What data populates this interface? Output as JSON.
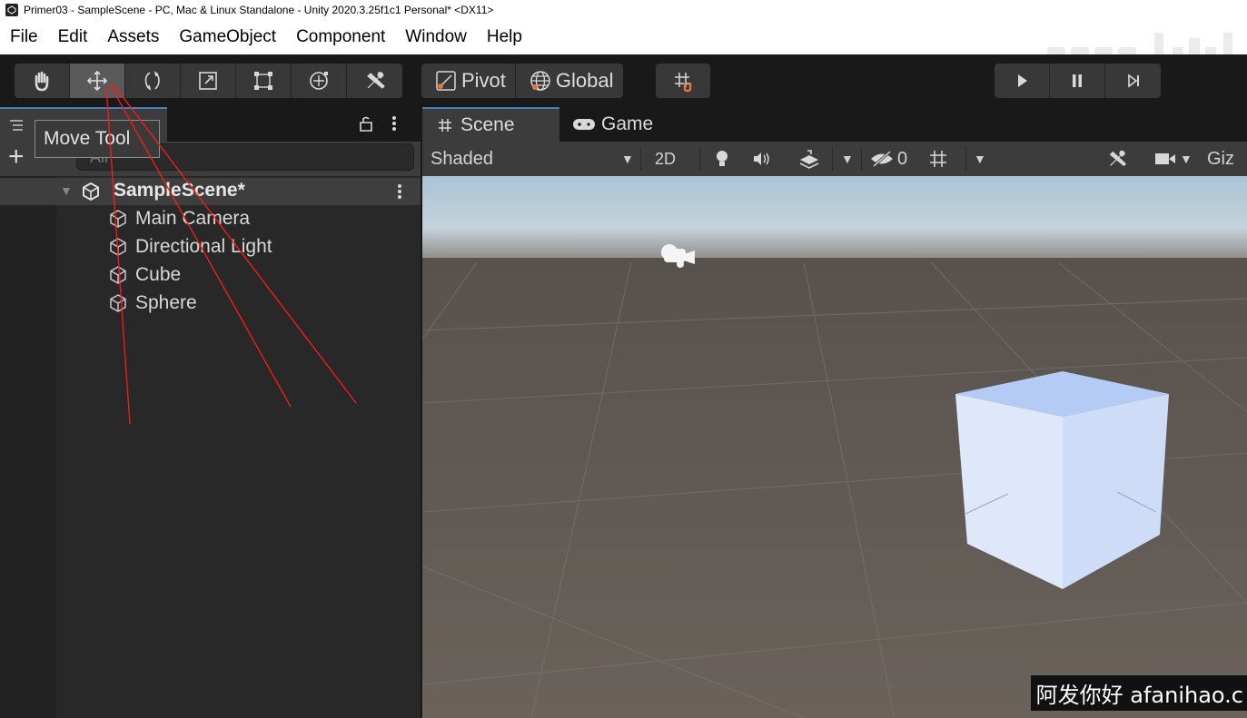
{
  "window": {
    "title": "Primer03 - SampleScene - PC, Mac & Linux Standalone - Unity 2020.3.25f1c1 Personal* <DX11>"
  },
  "menu": {
    "items": [
      "File",
      "Edit",
      "Assets",
      "GameObject",
      "Component",
      "Window",
      "Help"
    ]
  },
  "toolbar": {
    "tools": [
      {
        "name": "hand-tool",
        "icon": "hand-icon",
        "active": false
      },
      {
        "name": "move-tool",
        "icon": "move-icon",
        "active": true
      },
      {
        "name": "rotate-tool",
        "icon": "rotate-icon",
        "active": false
      },
      {
        "name": "scale-tool",
        "icon": "scale-icon",
        "active": false
      },
      {
        "name": "rect-tool",
        "icon": "rect-icon",
        "active": false
      },
      {
        "name": "transform-tool",
        "icon": "transform-icon",
        "active": false
      },
      {
        "name": "custom-tool",
        "icon": "tools-icon",
        "active": false
      }
    ],
    "pivot_label": "Pivot",
    "global_label": "Global"
  },
  "tooltip": {
    "text": "Move Tool"
  },
  "hierarchy": {
    "search_placeholder": "All",
    "scene_name": "SampleScene*",
    "objects": [
      "Main Camera",
      "Directional Light",
      "Cube",
      "Sphere"
    ]
  },
  "scene_view": {
    "tabs": {
      "scene": "Scene",
      "game": "Game"
    },
    "shading_mode": "Shaded",
    "mode_2d": "2D",
    "hidden_count": "0",
    "gizmos_label": "Giz"
  },
  "watermark": {
    "text": "阿发你好 afanihao.c"
  },
  "colors": {
    "accent": "#4a7ebb",
    "annotation": "#ff1a1a",
    "cube_top": "#b4ccf5",
    "cube_side": "#dfe8fb"
  }
}
